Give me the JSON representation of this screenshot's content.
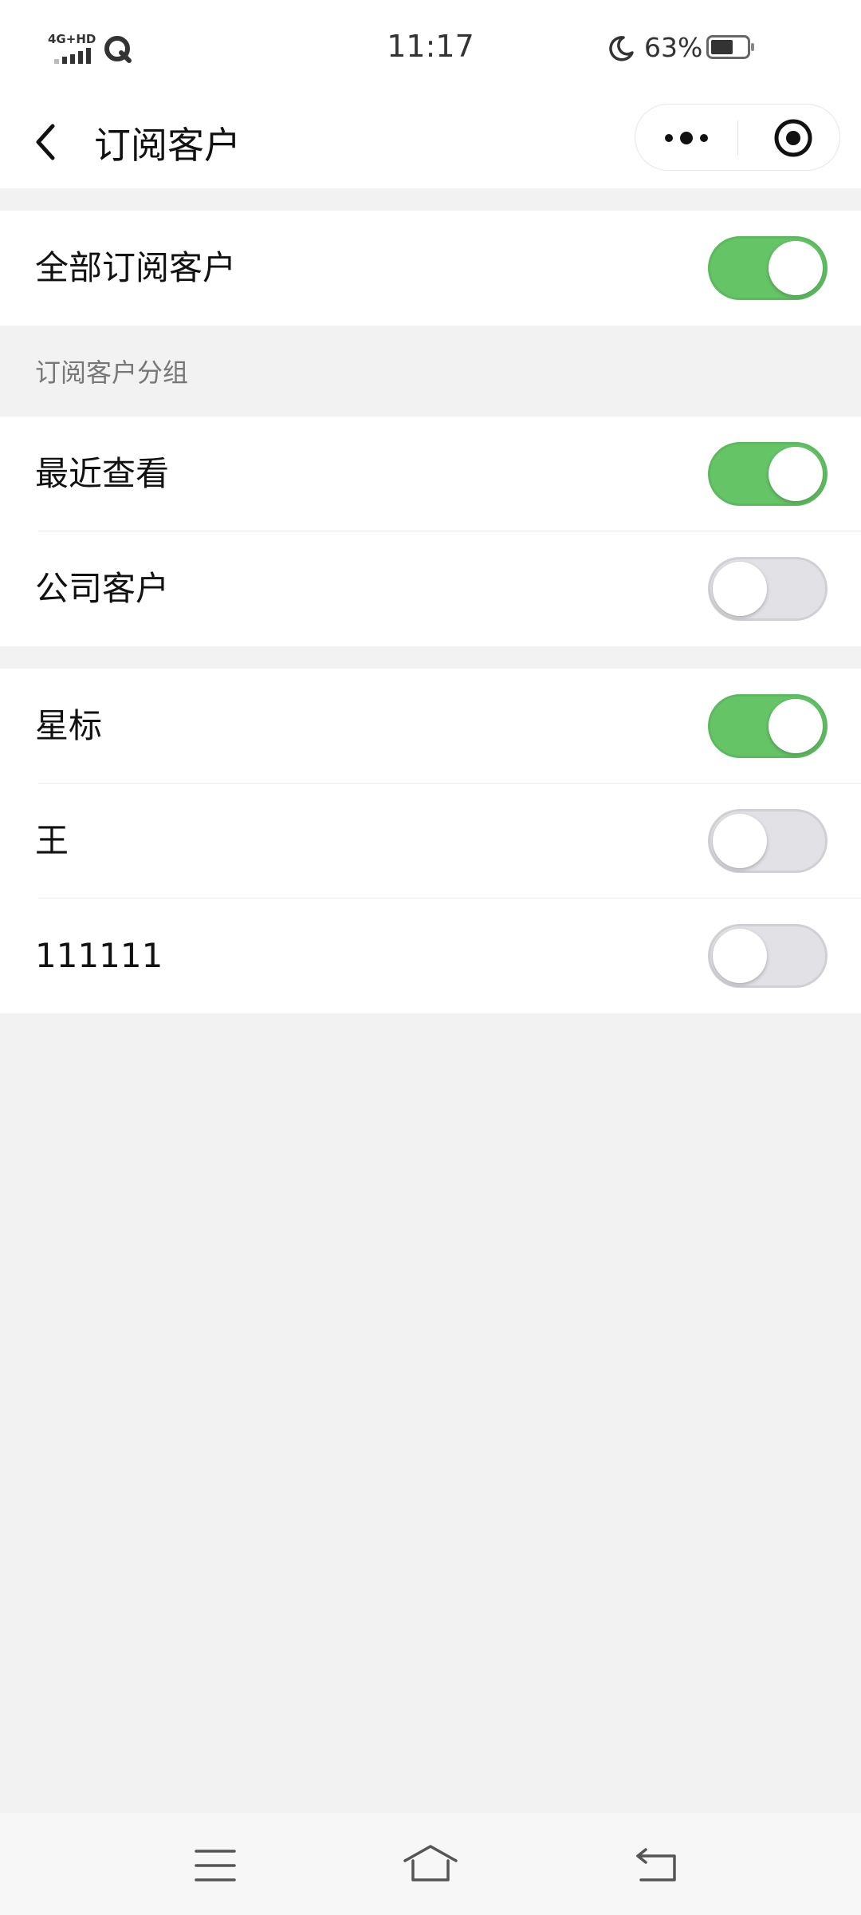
{
  "status_bar": {
    "network": "4G+HD",
    "time": "11:17",
    "battery_percent": "63%",
    "battery_level": 0.63,
    "icons": [
      "signal-icon",
      "qq-icon",
      "moon-icon",
      "battery-icon"
    ]
  },
  "header": {
    "title": "订阅客户",
    "icons": [
      "back-icon",
      "more-icon",
      "target-icon"
    ]
  },
  "all_subscribers": {
    "label": "全部订阅客户",
    "enabled": true
  },
  "groups_section": {
    "title": "订阅客户分组",
    "items": [
      {
        "label": "最近查看",
        "enabled": true
      },
      {
        "label": "公司客户",
        "enabled": false
      }
    ]
  },
  "tags_section": {
    "items": [
      {
        "label": "星标",
        "enabled": true
      },
      {
        "label": "王",
        "enabled": false
      },
      {
        "label": "111111",
        "enabled": false
      }
    ]
  },
  "colors": {
    "switch_on": "#64c466",
    "switch_off": "#e2e2e6",
    "background": "#f2f2f2"
  },
  "nav_bar": {
    "icons": [
      "menu-icon",
      "home-icon",
      "back-arrow-icon"
    ]
  }
}
